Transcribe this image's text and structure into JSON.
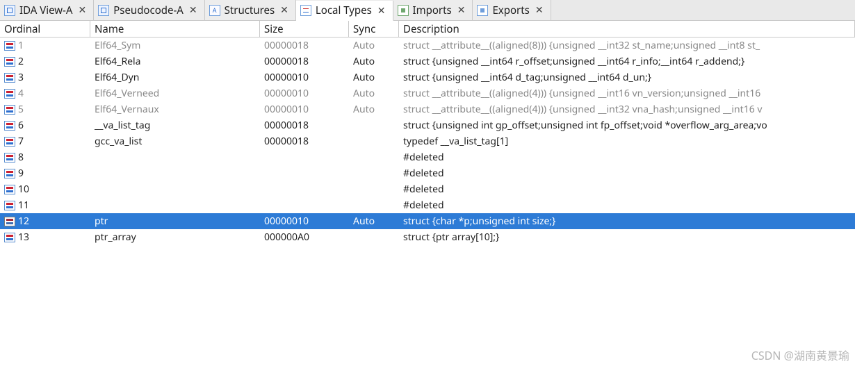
{
  "tabs": [
    {
      "label": "IDA View-A",
      "icon": "view",
      "active": false
    },
    {
      "label": "Pseudocode-A",
      "icon": "view",
      "active": false
    },
    {
      "label": "Structures",
      "icon": "struct",
      "active": false
    },
    {
      "label": "Local Types",
      "icon": "local",
      "active": true
    },
    {
      "label": "Imports",
      "icon": "imp",
      "active": false
    },
    {
      "label": "Exports",
      "icon": "exp",
      "active": false
    }
  ],
  "close_glyph": "✕",
  "columns": {
    "ordinal": "Ordinal",
    "name": "Name",
    "size": "Size",
    "sync": "Sync",
    "description": "Description"
  },
  "rows": [
    {
      "ordinal": "1",
      "name": "Elf64_Sym",
      "size": "00000018",
      "sync": "Auto",
      "desc": "struct __attribute__((aligned(8))) {unsigned __int32 st_name;unsigned __int8 st_",
      "dim": true,
      "selected": false
    },
    {
      "ordinal": "2",
      "name": "Elf64_Rela",
      "size": "00000018",
      "sync": "Auto",
      "desc": "struct {unsigned __int64 r_offset;unsigned __int64 r_info;__int64 r_addend;}",
      "dim": false,
      "selected": false
    },
    {
      "ordinal": "3",
      "name": "Elf64_Dyn",
      "size": "00000010",
      "sync": "Auto",
      "desc": "struct {unsigned __int64 d_tag;unsigned __int64 d_un;}",
      "dim": false,
      "selected": false
    },
    {
      "ordinal": "4",
      "name": "Elf64_Verneed",
      "size": "00000010",
      "sync": "Auto",
      "desc": "struct __attribute__((aligned(4))) {unsigned __int16 vn_version;unsigned __int16",
      "dim": true,
      "selected": false
    },
    {
      "ordinal": "5",
      "name": "Elf64_Vernaux",
      "size": "00000010",
      "sync": "Auto",
      "desc": "struct __attribute__((aligned(4))) {unsigned __int32 vna_hash;unsigned __int16 v",
      "dim": true,
      "selected": false
    },
    {
      "ordinal": "6",
      "name": "__va_list_tag",
      "size": "00000018",
      "sync": "",
      "desc": "struct {unsigned int gp_offset;unsigned int fp_offset;void *overflow_arg_area;vo",
      "dim": false,
      "selected": false
    },
    {
      "ordinal": "7",
      "name": "gcc_va_list",
      "size": "00000018",
      "sync": "",
      "desc": "typedef __va_list_tag[1]",
      "dim": false,
      "selected": false
    },
    {
      "ordinal": "8",
      "name": "",
      "size": "",
      "sync": "",
      "desc": "#deleted",
      "dim": false,
      "selected": false
    },
    {
      "ordinal": "9",
      "name": "",
      "size": "",
      "sync": "",
      "desc": "#deleted",
      "dim": false,
      "selected": false
    },
    {
      "ordinal": "10",
      "name": "",
      "size": "",
      "sync": "",
      "desc": "#deleted",
      "dim": false,
      "selected": false
    },
    {
      "ordinal": "11",
      "name": "",
      "size": "",
      "sync": "",
      "desc": "#deleted",
      "dim": false,
      "selected": false
    },
    {
      "ordinal": "12",
      "name": "ptr",
      "size": "00000010",
      "sync": "Auto",
      "desc": "struct {char *p;unsigned int size;}",
      "dim": false,
      "selected": true
    },
    {
      "ordinal": "13",
      "name": "ptr_array",
      "size": "000000A0",
      "sync": "",
      "desc": "struct {ptr array[10];}",
      "dim": false,
      "selected": false
    }
  ],
  "watermark": "CSDN @湖南黄景瑜"
}
